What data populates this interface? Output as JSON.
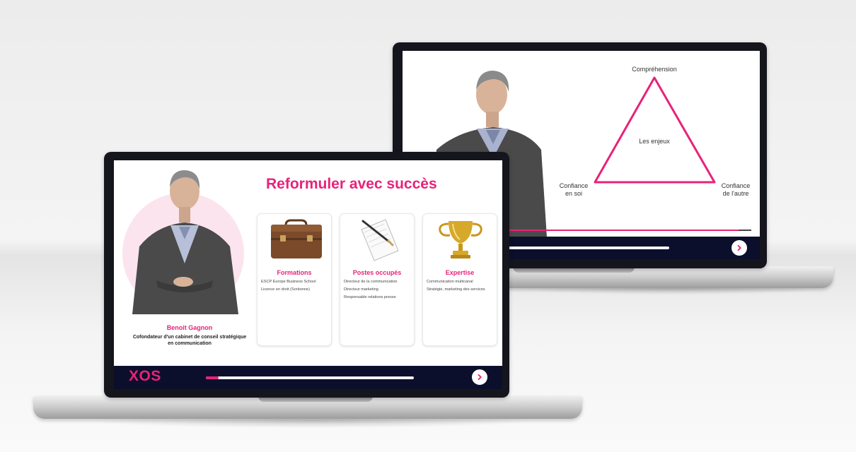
{
  "back_slide": {
    "labels": {
      "top": "Compréhension",
      "center": "Les enjeux",
      "left": "Confiance\nen soi",
      "right": "Confiance\nde l'autre"
    },
    "progress": 0.0
  },
  "front_slide": {
    "title": "Reformuler avec succès",
    "presenter": {
      "name": "Benoit Gagnon",
      "role": "Cofondateur d'un cabinet de conseil stratégique en communication"
    },
    "cards": [
      {
        "icon": "briefcase-icon",
        "title": "Formations",
        "items": [
          "ESCP Europe Business School",
          "Licence en droit (Sorbonne)"
        ]
      },
      {
        "icon": "notepad-icon",
        "title": "Postes occupés",
        "items": [
          "Directeur de la communication",
          "Directeur marketing",
          "Responsable relations presse"
        ]
      },
      {
        "icon": "trophy-icon",
        "title": "Expertise",
        "items": [
          "Communication multicanal",
          "Stratégie, marketing des services"
        ]
      }
    ],
    "logo": "XOS",
    "progress": 0.06
  },
  "colors": {
    "accent": "#e8227a",
    "bar": "#0c0f2c",
    "bezel": "#15151d",
    "presenter_circle": "#fbe4ee"
  }
}
